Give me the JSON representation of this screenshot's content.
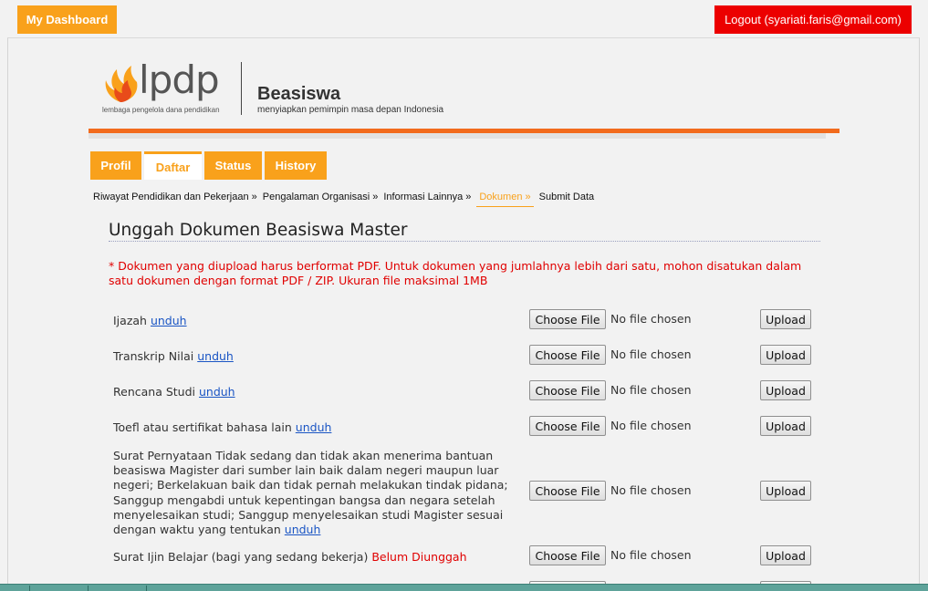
{
  "topbar": {
    "dashboard_label": "My Dashboard",
    "logout_label": "Logout (syariati.faris@gmail.com)"
  },
  "header": {
    "logo_text": "lpdp",
    "logo_tagline": "lembaga pengelola dana pendidikan",
    "title": "Beasiswa",
    "subtitle": "menyiapkan pemimpin masa depan Indonesia"
  },
  "tabs": [
    {
      "label": "Profil",
      "active": false
    },
    {
      "label": "Daftar",
      "active": true
    },
    {
      "label": "Status",
      "active": false
    },
    {
      "label": "History",
      "active": false
    }
  ],
  "steps": [
    {
      "label": "Riwayat Pendidikan dan Pekerjaan »",
      "active": false
    },
    {
      "label": "Pengalaman Organisasi »",
      "active": false
    },
    {
      "label": "Informasi Lainnya »",
      "active": false
    },
    {
      "label": "Dokumen »",
      "active": true
    },
    {
      "label": "Submit Data",
      "active": false
    }
  ],
  "main": {
    "title": "Unggah Dokumen Beasiswa Master",
    "notice": "* Dokumen yang diupload harus berformat PDF. Untuk dokumen yang jumlahnya lebih dari satu, mohon disatukan dalam satu dokumen dengan format PDF / ZIP. Ukuran file maksimal 1MB",
    "choose_label": "Choose File",
    "no_file_label": "No file chosen",
    "upload_label": "Upload",
    "documents": [
      {
        "label": "Ijazah",
        "link": "unduh",
        "status": ""
      },
      {
        "label": "Transkrip Nilai",
        "link": "unduh",
        "status": ""
      },
      {
        "label": "Rencana Studi",
        "link": "unduh",
        "status": ""
      },
      {
        "label": "Toefl atau sertifikat bahasa lain",
        "link": "unduh",
        "status": ""
      },
      {
        "label": "Surat Pernyataan Tidak sedang dan tidak akan menerima bantuan beasiswa Magister dari sumber lain baik dalam negeri maupun luar negeri; Berkelakuan baik dan tidak pernah melakukan tindak pidana; Sanggup mengabdi untuk kepentingan bangsa dan negara setelah menyelesaikan studi; Sanggup menyelesaikan studi Magister sesuai dengan waktu yang tentukan",
        "link": "unduh",
        "status": ""
      },
      {
        "label": "Surat Ijin Belajar (bagi yang sedang bekerja)",
        "link": "",
        "status": "Belum Diunggah"
      }
    ]
  },
  "colors": {
    "accent_orange": "#f9a11b",
    "logout_red": "#ec0000",
    "rule_orange": "#f26b1d",
    "link_blue": "#1a55c4",
    "notice_red": "#e00000"
  },
  "icons": {
    "logo": "lpdp-flame-icon"
  }
}
